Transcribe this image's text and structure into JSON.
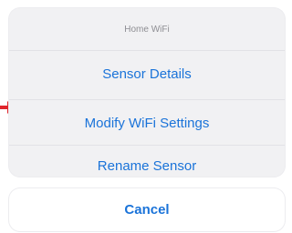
{
  "sheet": {
    "title": "Home WiFi",
    "actions": [
      {
        "label": "Sensor Details"
      },
      {
        "label": "Modify WiFi Settings"
      },
      {
        "label": "Rename Sensor"
      }
    ],
    "cancel_label": "Cancel"
  },
  "colors": {
    "accent": "#1a73d9",
    "sheet_background": "#f1f1f3",
    "title_text": "#8e8e93",
    "arrow": "#e0242b"
  },
  "icons": {
    "pointer": "arrow-right-icon"
  }
}
